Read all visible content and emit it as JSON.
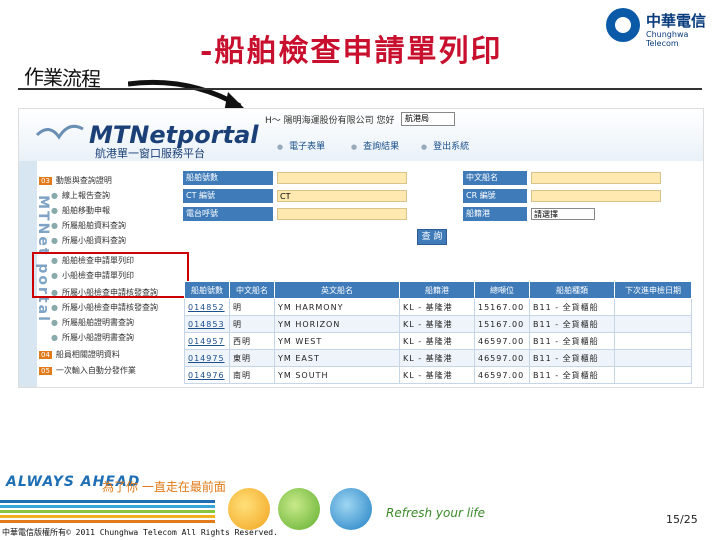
{
  "slide": {
    "title": "-船舶檢查申請單列印",
    "handwriting": "作業流程",
    "page_number": "15/25",
    "copyright": "中華電信版權所有© 2011 Chunghwa Telecom All Rights Reserved.",
    "logo_zh": "中華電信",
    "logo_en": "Chunghwa Telecom",
    "slogan": "ALWAYS AHEAD",
    "slogan_zh": "為了你 一直走在最前面",
    "refresh": "Refresh your life"
  },
  "portal": {
    "brand": "MTNetportal",
    "subtitle": "航港單一窗口服務平台",
    "side_title": "MTNet portal",
    "greeting": "H～ 陽明海運股份有限公司 您好",
    "port_select": "航港局",
    "tabs": [
      "電子表單",
      "查詢結果",
      "登出系統"
    ]
  },
  "nav": [
    {
      "num": "03",
      "label": "動態與查詢證明"
    },
    {
      "label": "線上報告查詢"
    },
    {
      "label": "船舶移動申報"
    },
    {
      "label": "所屬船舶資料查詢"
    },
    {
      "label": "所屬小船資料查詢"
    },
    {
      "label": "船舶檢查申請單列印"
    },
    {
      "label": "小船檢查申請單列印"
    },
    {
      "label": "所屬小船檢查申請核發查詢"
    },
    {
      "label": "所屬小船檢查申請核發查詢"
    },
    {
      "label": "所屬船舶證明書查詢"
    },
    {
      "label": "所屬小船證明書查詢"
    },
    {
      "num": "04",
      "label": "船員相關證明資料"
    },
    {
      "num": "05",
      "label": "一次輸入自動分發作業"
    }
  ],
  "form": {
    "labels": [
      "船舶號數",
      "CT 編號",
      "電台呼號",
      "中文船名",
      "CR 編號",
      "船籍港"
    ],
    "ct_value": "CT",
    "port_value": "請選擇",
    "query_button": "查 詢"
  },
  "table": {
    "headers": [
      "船舶號數",
      "中文船名",
      "英文船名",
      "船籍港",
      "總噸位",
      "船舶種類",
      "下次進申檢日期"
    ],
    "rows": [
      [
        "014852",
        "明",
        "YM HARMONY",
        "KL - 基隆港",
        "15167.00",
        "B11 - 全貨櫃船",
        ""
      ],
      [
        "014853",
        "明",
        "YM HORIZON",
        "KL - 基隆港",
        "15167.00",
        "B11 - 全貨櫃船",
        ""
      ],
      [
        "014957",
        "西明",
        "YM WEST",
        "KL - 基隆港",
        "46597.00",
        "B11 - 全貨櫃船",
        ""
      ],
      [
        "014975",
        "東明",
        "YM EAST",
        "KL - 基隆港",
        "46597.00",
        "B11 - 全貨櫃船",
        ""
      ],
      [
        "014976",
        "南明",
        "YM SOUTH",
        "KL - 基隆港",
        "46597.00",
        "B11 - 全貨櫃船",
        ""
      ]
    ]
  },
  "colors": {
    "title": "#c8102e",
    "portal_blue": "#3e7bb8",
    "input_yellow": "#ffe9b0",
    "highlight": "#cc0000"
  }
}
